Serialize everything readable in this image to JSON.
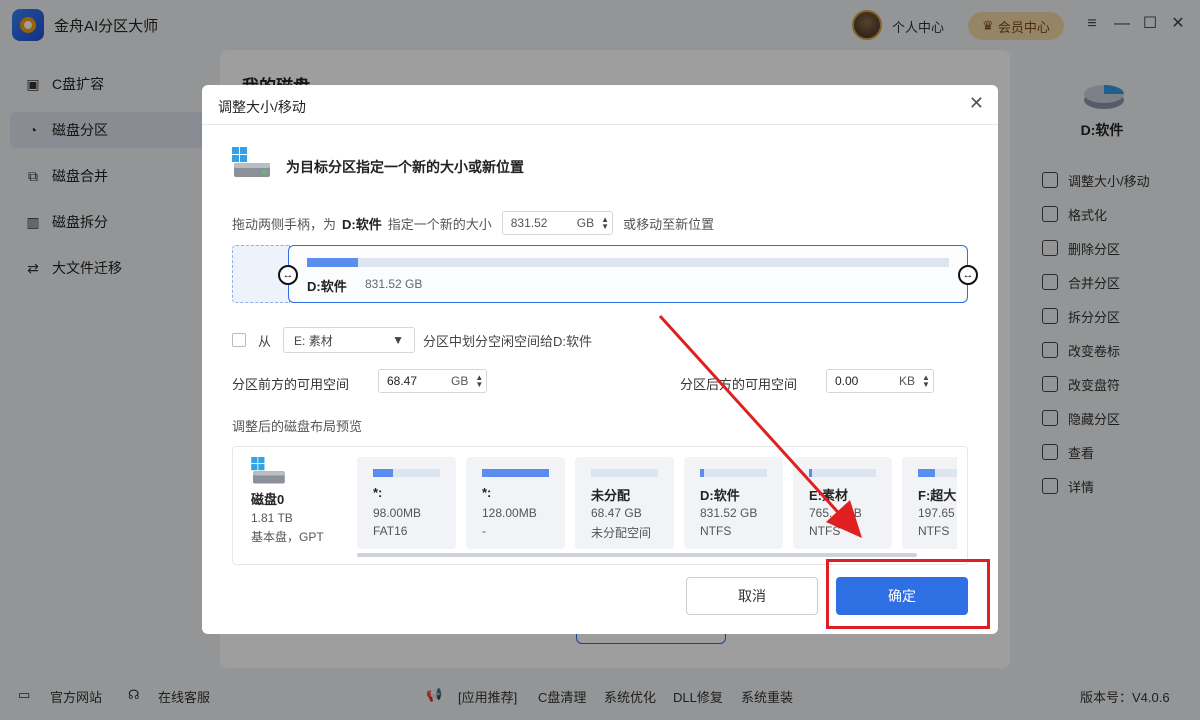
{
  "app": {
    "title": "金舟AI分区大师",
    "user_center": "个人中心",
    "vip": "会员中心"
  },
  "sidebar": {
    "items": [
      {
        "label": "C盘扩容"
      },
      {
        "label": "磁盘分区"
      },
      {
        "label": "磁盘合并"
      },
      {
        "label": "磁盘拆分"
      },
      {
        "label": "大文件迁移"
      }
    ]
  },
  "main": {
    "title": "我的磁盘"
  },
  "right_panel": {
    "drive": "D:软件",
    "items": [
      {
        "label": "调整大小/移动"
      },
      {
        "label": "格式化"
      },
      {
        "label": "删除分区"
      },
      {
        "label": "合并分区"
      },
      {
        "label": "拆分分区"
      },
      {
        "label": "改变卷标"
      },
      {
        "label": "改变盘符"
      },
      {
        "label": "隐藏分区"
      },
      {
        "label": "查看"
      },
      {
        "label": "详情"
      }
    ]
  },
  "footer": {
    "website": "官方网站",
    "support": "在线客服",
    "recommend": "[应用推荐]",
    "c_clean": "C盘清理",
    "optimize": "系统优化",
    "dll": "DLL修复",
    "reinstall": "系统重装",
    "version": "版本号：V4.0.6"
  },
  "dialog": {
    "title": "调整大小/移动",
    "heading": "为目标分区指定一个新的大小或新位置",
    "hint_prefix": "拖动两侧手柄，为",
    "hint_drive": "D:软件",
    "hint_mid": "指定一个新的大小",
    "size_value": "831.52",
    "size_unit": "GB",
    "hint_suffix": "或移动至新位置",
    "partition": {
      "name": "D:软件",
      "size": "831.52 GB",
      "fill": 0.08
    },
    "from_label": "从",
    "from_select": "E: 素材",
    "from_suffix": "分区中划分空闲空间给D:软件",
    "before_label": "分区前方的可用空间",
    "before_value": "68.47",
    "before_unit": "GB",
    "after_label": "分区后方的可用空间",
    "after_value": "0.00",
    "after_unit": "KB",
    "preview_label": "调整后的磁盘布局预览",
    "disk": {
      "name": "磁盘0",
      "size": "1.81 TB",
      "type": "基本盘，GPT"
    },
    "cards": [
      {
        "name": "*:",
        "size": "98.00MB",
        "fs": "FAT16",
        "fill": 0.3
      },
      {
        "name": "*:",
        "size": "128.00MB",
        "fs": "-",
        "fill": 1.0
      },
      {
        "name": "未分配",
        "size": "68.47 GB",
        "fs": "未分配空间",
        "fill": 0
      },
      {
        "name": "D:软件",
        "size": "831.52 GB",
        "fs": "NTFS",
        "fill": 0.06
      },
      {
        "name": "E:素材",
        "size": "765.…GB",
        "fs": "NTFS",
        "fill": 0.05
      },
      {
        "name": "F:超大",
        "size": "197.65",
        "fs": "NTFS",
        "fill": 0.25
      }
    ],
    "cancel": "取消",
    "ok": "确定"
  }
}
